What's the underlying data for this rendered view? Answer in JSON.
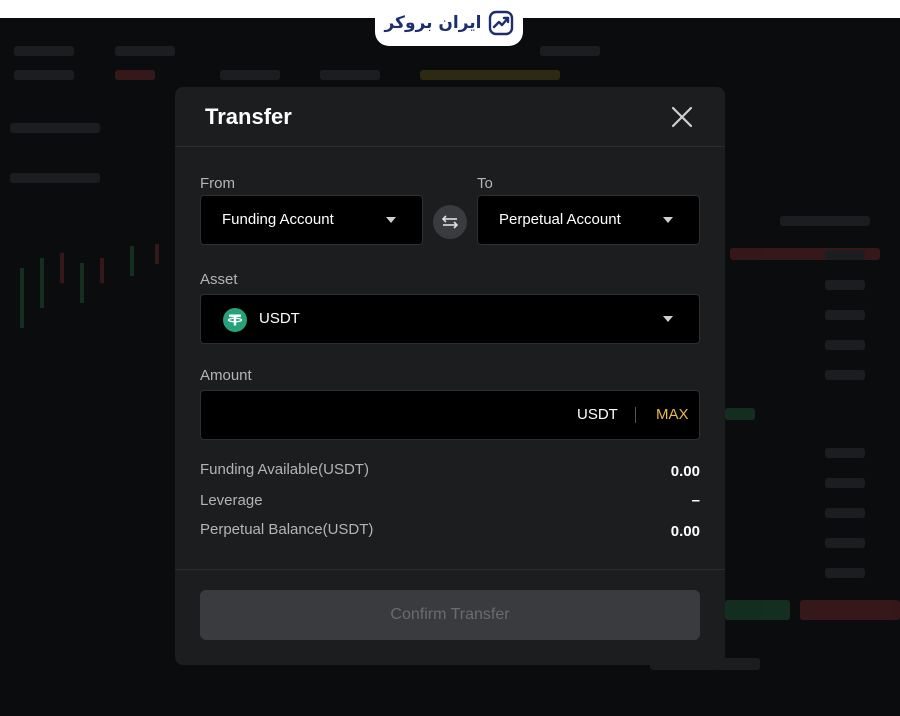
{
  "brand": {
    "name": "ایران بروکر"
  },
  "modal": {
    "title": "Transfer",
    "from": {
      "label": "From",
      "value": "Funding Account"
    },
    "to": {
      "label": "To",
      "value": "Perpetual Account"
    },
    "asset": {
      "label": "Asset",
      "value": "USDT"
    },
    "amount": {
      "label": "Amount",
      "value": "",
      "unit": "USDT",
      "max_label": "MAX"
    },
    "info": [
      {
        "label": "Funding Available(USDT)",
        "value": "0.00"
      },
      {
        "label": "Leverage",
        "value": "–"
      },
      {
        "label": "Perpetual Balance(USDT)",
        "value": "0.00"
      }
    ],
    "confirm_label": "Confirm Transfer"
  },
  "colors": {
    "accent": "#e9b949",
    "usdt": "#26a17b",
    "modal_bg": "#1c1d1f",
    "brand": "#1c2e6e"
  },
  "icons": {
    "close": "close-icon",
    "swap": "swap-arrows-icon",
    "caret": "caret-down-icon",
    "coin": "usdt-icon",
    "brand": "chart-trend-icon"
  }
}
